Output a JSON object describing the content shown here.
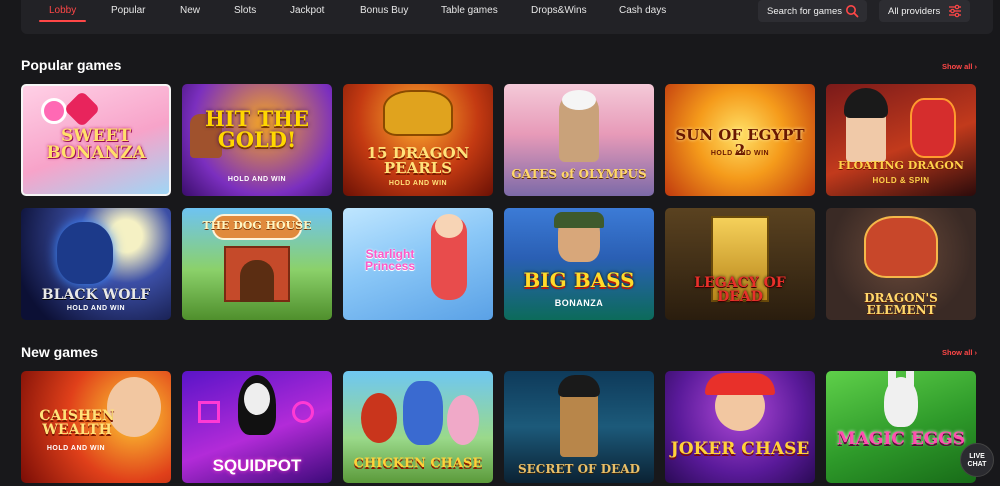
{
  "nav": {
    "tabs": [
      "Lobby",
      "Popular",
      "New",
      "Slots",
      "Jackpot",
      "Bonus Buy",
      "Table games",
      "Drops&Wins",
      "Cash days"
    ],
    "active_tab": "Lobby",
    "search_label": "Search for games",
    "providers_label": "All providers"
  },
  "sections": {
    "popular": {
      "title": "Popular games",
      "show_all": "Show all ›",
      "games": [
        {
          "title": "SWEET BONANZA",
          "subtitle": ""
        },
        {
          "title": "HIT THE GOLD!",
          "subtitle": "HOLD AND WIN"
        },
        {
          "title": "15 DRAGON PEARLS",
          "subtitle": "HOLD AND WIN"
        },
        {
          "title": "GATES of OLYMPUS",
          "subtitle": ""
        },
        {
          "title": "SUN OF EGYPT 2",
          "subtitle": "HOLD AND WIN"
        },
        {
          "title": "FLOATING DRAGON",
          "subtitle": "HOLD & SPIN"
        },
        {
          "title": "BLACK WOLF",
          "subtitle": "HOLD AND WIN"
        },
        {
          "title": "THE DOG HOUSE",
          "subtitle": ""
        },
        {
          "title": "Starlight Princess",
          "subtitle": ""
        },
        {
          "title": "BIG BASS",
          "subtitle": "BONANZA"
        },
        {
          "title": "LEGACY OF DEAD",
          "subtitle": ""
        },
        {
          "title": "DRAGON'S ELEMENT",
          "subtitle": ""
        }
      ]
    },
    "new": {
      "title": "New games",
      "show_all": "Show all ›",
      "games": [
        {
          "title": "CAISHEN WEALTH",
          "subtitle": "HOLD AND WIN"
        },
        {
          "title": "SQUIDPOT",
          "subtitle": ""
        },
        {
          "title": "CHICKEN CHASE",
          "subtitle": ""
        },
        {
          "title": "SECRET OF DEAD",
          "subtitle": ""
        },
        {
          "title": "JOKER CHASE",
          "subtitle": ""
        },
        {
          "title": "MAGIC EGGS",
          "subtitle": ""
        }
      ]
    }
  },
  "live_chat": "LIVE CHAT",
  "icons": {
    "search": "search-icon",
    "filter": "filter-sliders-icon"
  },
  "colors": {
    "accent": "#ff4747",
    "background": "#18181b",
    "nav_bg": "#222226"
  }
}
